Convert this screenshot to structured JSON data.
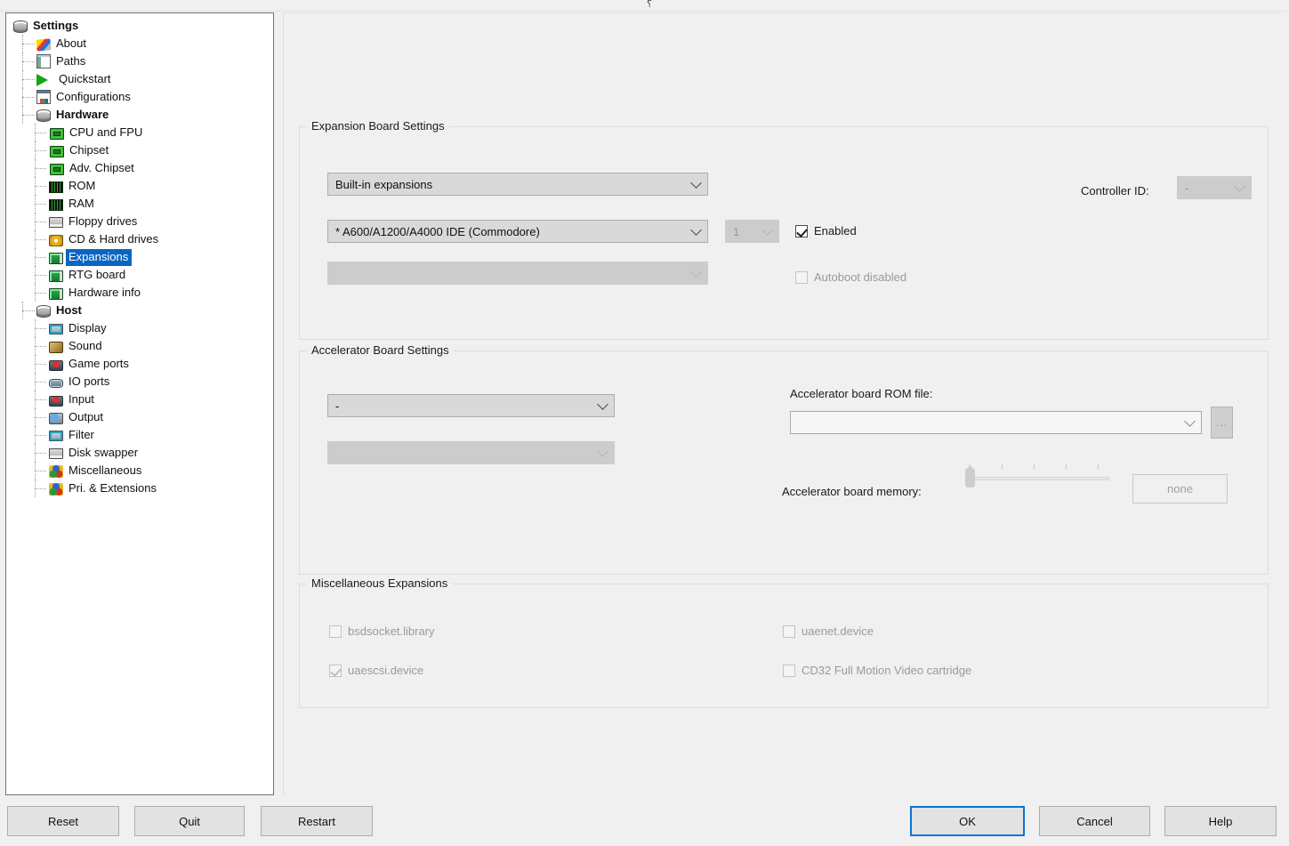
{
  "window": {
    "top_glyph": "⸮"
  },
  "sidebar": {
    "items": [
      {
        "label": "Settings",
        "icon": "db-icon",
        "level": 0,
        "bold": true,
        "selected": false
      },
      {
        "label": "About",
        "icon": "pencil-icon",
        "level": 1,
        "bold": false,
        "selected": false
      },
      {
        "label": "Paths",
        "icon": "paths-icon",
        "level": 1,
        "bold": false,
        "selected": false
      },
      {
        "label": "Quickstart",
        "icon": "play-icon",
        "level": 1,
        "bold": false,
        "selected": false
      },
      {
        "label": "Configurations",
        "icon": "config-icon",
        "level": 1,
        "bold": false,
        "selected": false
      },
      {
        "label": "Hardware",
        "icon": "db-icon",
        "level": 1,
        "bold": true,
        "selected": false
      },
      {
        "label": "CPU and FPU",
        "icon": "chip-icon",
        "level": 2,
        "bold": false,
        "selected": false
      },
      {
        "label": "Chipset",
        "icon": "chip-icon",
        "level": 2,
        "bold": false,
        "selected": false
      },
      {
        "label": "Adv. Chipset",
        "icon": "chip-icon",
        "level": 2,
        "bold": false,
        "selected": false
      },
      {
        "label": "ROM",
        "icon": "rom-icon",
        "level": 2,
        "bold": false,
        "selected": false
      },
      {
        "label": "RAM",
        "icon": "rom-icon",
        "level": 2,
        "bold": false,
        "selected": false
      },
      {
        "label": "Floppy drives",
        "icon": "floppy-icon",
        "level": 2,
        "bold": false,
        "selected": false
      },
      {
        "label": "CD & Hard drives",
        "icon": "cd-icon",
        "level": 2,
        "bold": false,
        "selected": false
      },
      {
        "label": "Expansions",
        "icon": "board-icon",
        "level": 2,
        "bold": false,
        "selected": true
      },
      {
        "label": "RTG board",
        "icon": "board-icon",
        "level": 2,
        "bold": false,
        "selected": false
      },
      {
        "label": "Hardware info",
        "icon": "board-icon",
        "level": 2,
        "bold": false,
        "selected": false
      },
      {
        "label": "Host",
        "icon": "db-icon",
        "level": 1,
        "bold": true,
        "selected": false
      },
      {
        "label": "Display",
        "icon": "monitor-icon",
        "level": 2,
        "bold": false,
        "selected": false
      },
      {
        "label": "Sound",
        "icon": "sound-icon",
        "level": 2,
        "bold": false,
        "selected": false
      },
      {
        "label": "Game ports",
        "icon": "joystick-icon",
        "level": 2,
        "bold": false,
        "selected": false
      },
      {
        "label": "IO ports",
        "icon": "io-icon",
        "level": 2,
        "bold": false,
        "selected": false
      },
      {
        "label": "Input",
        "icon": "joystick-icon",
        "level": 2,
        "bold": false,
        "selected": false
      },
      {
        "label": "Output",
        "icon": "output-icon",
        "level": 2,
        "bold": false,
        "selected": false
      },
      {
        "label": "Filter",
        "icon": "monitor-icon",
        "level": 2,
        "bold": false,
        "selected": false
      },
      {
        "label": "Disk swapper",
        "icon": "floppy-icon",
        "level": 2,
        "bold": false,
        "selected": false
      },
      {
        "label": "Miscellaneous",
        "icon": "misc-icon",
        "level": 2,
        "bold": false,
        "selected": false
      },
      {
        "label": "Pri. & Extensions",
        "icon": "misc-icon",
        "level": 2,
        "bold": false,
        "selected": false
      }
    ],
    "selection_color": "#0a66c2"
  },
  "expansion_group": {
    "legend": "Expansion Board Settings",
    "category_combo": {
      "value": "Built-in expansions",
      "enabled": true
    },
    "board_combo": {
      "value": "* A600/A1200/A4000 IDE (Commodore)",
      "enabled": true
    },
    "count_combo": {
      "value": "1",
      "enabled": false
    },
    "sub_combo": {
      "value": "",
      "enabled": false
    },
    "enabled_checkbox": {
      "label": "Enabled",
      "checked": true,
      "enabled": true
    },
    "autoboot_checkbox": {
      "label": "Autoboot disabled",
      "checked": false,
      "enabled": false
    },
    "controller_id_label": "Controller ID:",
    "controller_id_combo": {
      "value": "-",
      "enabled": false
    }
  },
  "accelerator_group": {
    "legend": "Accelerator Board Settings",
    "board_combo": {
      "value": "-",
      "enabled": true
    },
    "sub_combo": {
      "value": "",
      "enabled": false
    },
    "rom_file_label": "Accelerator board ROM file:",
    "rom_file_combo": {
      "value": "",
      "enabled": true
    },
    "browse_button": "...",
    "memory_label": "Accelerator board memory:",
    "memory_slider": {
      "value": 0,
      "min": 0,
      "max": 5,
      "ticks": 5
    },
    "memory_value": "none"
  },
  "misc_group": {
    "legend": "Miscellaneous Expansions",
    "items": [
      {
        "label": "bsdsocket.library",
        "checked": false,
        "enabled": false
      },
      {
        "label": "uaenet.device",
        "checked": false,
        "enabled": false
      },
      {
        "label": "uaescsi.device",
        "checked": true,
        "enabled": false
      },
      {
        "label": "CD32 Full Motion Video cartridge",
        "checked": false,
        "enabled": false
      }
    ]
  },
  "bottom_bar": {
    "left_buttons": [
      {
        "label": "Reset",
        "primary": false
      },
      {
        "label": "Quit",
        "primary": false
      },
      {
        "label": "Restart",
        "primary": false
      }
    ],
    "right_buttons": [
      {
        "label": "OK",
        "primary": true
      },
      {
        "label": "Cancel",
        "primary": false
      },
      {
        "label": "Help",
        "primary": false
      }
    ],
    "focus_color": "#0a74d8"
  }
}
